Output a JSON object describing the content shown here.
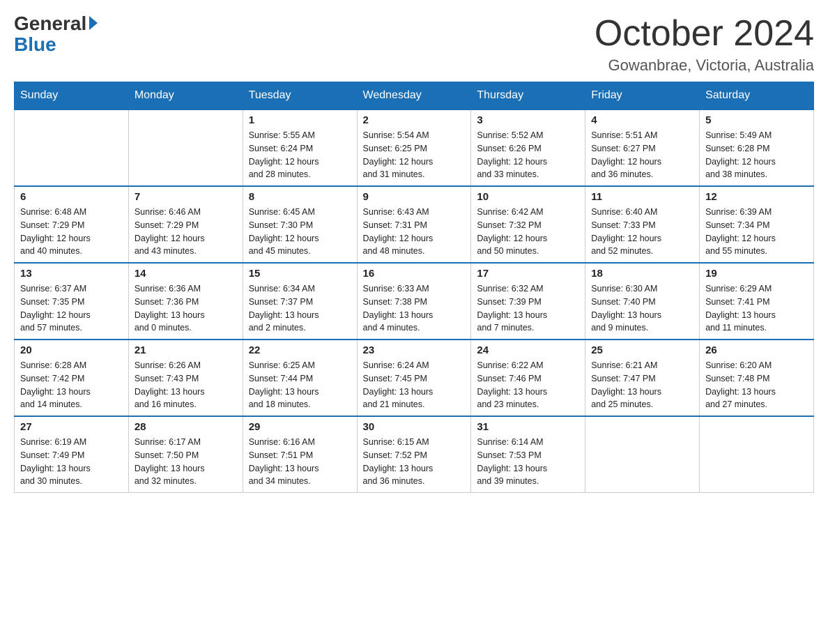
{
  "logo": {
    "general": "General",
    "blue": "Blue"
  },
  "title": "October 2024",
  "location": "Gowanbrae, Victoria, Australia",
  "days_of_week": [
    "Sunday",
    "Monday",
    "Tuesday",
    "Wednesday",
    "Thursday",
    "Friday",
    "Saturday"
  ],
  "weeks": [
    [
      {
        "day": "",
        "info": ""
      },
      {
        "day": "",
        "info": ""
      },
      {
        "day": "1",
        "info": "Sunrise: 5:55 AM\nSunset: 6:24 PM\nDaylight: 12 hours\nand 28 minutes."
      },
      {
        "day": "2",
        "info": "Sunrise: 5:54 AM\nSunset: 6:25 PM\nDaylight: 12 hours\nand 31 minutes."
      },
      {
        "day": "3",
        "info": "Sunrise: 5:52 AM\nSunset: 6:26 PM\nDaylight: 12 hours\nand 33 minutes."
      },
      {
        "day": "4",
        "info": "Sunrise: 5:51 AM\nSunset: 6:27 PM\nDaylight: 12 hours\nand 36 minutes."
      },
      {
        "day": "5",
        "info": "Sunrise: 5:49 AM\nSunset: 6:28 PM\nDaylight: 12 hours\nand 38 minutes."
      }
    ],
    [
      {
        "day": "6",
        "info": "Sunrise: 6:48 AM\nSunset: 7:29 PM\nDaylight: 12 hours\nand 40 minutes."
      },
      {
        "day": "7",
        "info": "Sunrise: 6:46 AM\nSunset: 7:29 PM\nDaylight: 12 hours\nand 43 minutes."
      },
      {
        "day": "8",
        "info": "Sunrise: 6:45 AM\nSunset: 7:30 PM\nDaylight: 12 hours\nand 45 minutes."
      },
      {
        "day": "9",
        "info": "Sunrise: 6:43 AM\nSunset: 7:31 PM\nDaylight: 12 hours\nand 48 minutes."
      },
      {
        "day": "10",
        "info": "Sunrise: 6:42 AM\nSunset: 7:32 PM\nDaylight: 12 hours\nand 50 minutes."
      },
      {
        "day": "11",
        "info": "Sunrise: 6:40 AM\nSunset: 7:33 PM\nDaylight: 12 hours\nand 52 minutes."
      },
      {
        "day": "12",
        "info": "Sunrise: 6:39 AM\nSunset: 7:34 PM\nDaylight: 12 hours\nand 55 minutes."
      }
    ],
    [
      {
        "day": "13",
        "info": "Sunrise: 6:37 AM\nSunset: 7:35 PM\nDaylight: 12 hours\nand 57 minutes."
      },
      {
        "day": "14",
        "info": "Sunrise: 6:36 AM\nSunset: 7:36 PM\nDaylight: 13 hours\nand 0 minutes."
      },
      {
        "day": "15",
        "info": "Sunrise: 6:34 AM\nSunset: 7:37 PM\nDaylight: 13 hours\nand 2 minutes."
      },
      {
        "day": "16",
        "info": "Sunrise: 6:33 AM\nSunset: 7:38 PM\nDaylight: 13 hours\nand 4 minutes."
      },
      {
        "day": "17",
        "info": "Sunrise: 6:32 AM\nSunset: 7:39 PM\nDaylight: 13 hours\nand 7 minutes."
      },
      {
        "day": "18",
        "info": "Sunrise: 6:30 AM\nSunset: 7:40 PM\nDaylight: 13 hours\nand 9 minutes."
      },
      {
        "day": "19",
        "info": "Sunrise: 6:29 AM\nSunset: 7:41 PM\nDaylight: 13 hours\nand 11 minutes."
      }
    ],
    [
      {
        "day": "20",
        "info": "Sunrise: 6:28 AM\nSunset: 7:42 PM\nDaylight: 13 hours\nand 14 minutes."
      },
      {
        "day": "21",
        "info": "Sunrise: 6:26 AM\nSunset: 7:43 PM\nDaylight: 13 hours\nand 16 minutes."
      },
      {
        "day": "22",
        "info": "Sunrise: 6:25 AM\nSunset: 7:44 PM\nDaylight: 13 hours\nand 18 minutes."
      },
      {
        "day": "23",
        "info": "Sunrise: 6:24 AM\nSunset: 7:45 PM\nDaylight: 13 hours\nand 21 minutes."
      },
      {
        "day": "24",
        "info": "Sunrise: 6:22 AM\nSunset: 7:46 PM\nDaylight: 13 hours\nand 23 minutes."
      },
      {
        "day": "25",
        "info": "Sunrise: 6:21 AM\nSunset: 7:47 PM\nDaylight: 13 hours\nand 25 minutes."
      },
      {
        "day": "26",
        "info": "Sunrise: 6:20 AM\nSunset: 7:48 PM\nDaylight: 13 hours\nand 27 minutes."
      }
    ],
    [
      {
        "day": "27",
        "info": "Sunrise: 6:19 AM\nSunset: 7:49 PM\nDaylight: 13 hours\nand 30 minutes."
      },
      {
        "day": "28",
        "info": "Sunrise: 6:17 AM\nSunset: 7:50 PM\nDaylight: 13 hours\nand 32 minutes."
      },
      {
        "day": "29",
        "info": "Sunrise: 6:16 AM\nSunset: 7:51 PM\nDaylight: 13 hours\nand 34 minutes."
      },
      {
        "day": "30",
        "info": "Sunrise: 6:15 AM\nSunset: 7:52 PM\nDaylight: 13 hours\nand 36 minutes."
      },
      {
        "day": "31",
        "info": "Sunrise: 6:14 AM\nSunset: 7:53 PM\nDaylight: 13 hours\nand 39 minutes."
      },
      {
        "day": "",
        "info": ""
      },
      {
        "day": "",
        "info": ""
      }
    ]
  ]
}
